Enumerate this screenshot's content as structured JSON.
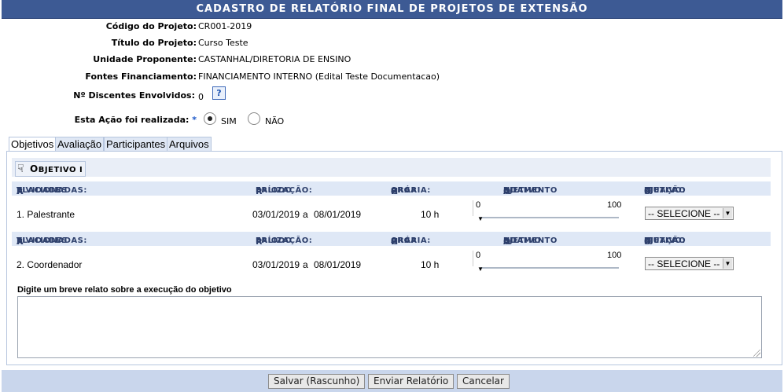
{
  "form": {
    "title": "CADASTRO DE RELATÓRIO FINAL DE PROJETOS DE EXTENSÃO",
    "fields": {
      "codigo_label": "Código do Projeto:",
      "codigo_value": "CR001-2019",
      "titulo_label": "Título do Projeto:",
      "titulo_value": "Curso Teste",
      "unidade_label": "Unidade Proponente:",
      "unidade_value": "CASTANHAL/DIRETORIA DE ENSINO",
      "fontes_label": "Fontes Financiamento:",
      "fontes_value": "FINANCIAMENTO INTERNO (Edital Teste Documentacao)",
      "discentes_label": "Nº Discentes Envolvidos:",
      "discentes_value": "0",
      "help_icon": "?",
      "realizada_label": "Esta Ação foi realizada:",
      "required_mark": "*",
      "sim_label": "SIM",
      "nao_label": "NÃO",
      "realizada_selected": "SIM"
    }
  },
  "tabs": [
    {
      "label": "Objetivos",
      "active": true
    },
    {
      "label": "Avaliação",
      "active": false
    },
    {
      "label": "Participantes",
      "active": false
    },
    {
      "label": "Arquivos",
      "active": false
    }
  ],
  "objective": {
    "button_first": "O",
    "button_rest": "BJETIVO I",
    "headers": {
      "atividades_cap": "A",
      "atividades_rest": "TIVIDADES ",
      "atividades_cap2": "R",
      "atividades_rest2": "ELACIONADAS:",
      "periodo_cap": "P",
      "periodo_rest": "ERÍODO ",
      "periodo_cap2": "R",
      "periodo_rest2": "EALIZAÇÃO:",
      "carga_cap": "C",
      "carga_rest": "ARGA ",
      "carga_cap2": "H",
      "carga_rest2": "ORÁRIA:",
      "andamento_cap": "A",
      "andamento_rest": "NDAMENTO ",
      "andamento_cap2": "O",
      "andamento_rest2": "BJETIVO:",
      "situacao_cap": "S",
      "situacao_rest": "ITUAÇÃO ",
      "situacao_cap2": "O",
      "situacao_rest2": "BJETIVO:"
    },
    "activities": [
      {
        "name": "1. Palestrante",
        "start": "03/01/2019",
        "sep": "a",
        "end": "08/01/2019",
        "hours": "10 h",
        "progress_min": "0",
        "progress_max": "100",
        "progress": 0,
        "situacao": "-- SELECIONE --"
      },
      {
        "name": "2. Coordenador",
        "start": "03/01/2019",
        "sep": "a",
        "end": "08/01/2019",
        "hours": "10 h",
        "progress_min": "0",
        "progress_max": "100",
        "progress": 0,
        "situacao": "-- SELECIONE --"
      }
    ],
    "relato_label": "Digite um breve relato sobre a execução do objetivo",
    "relato_value": ""
  },
  "footer": {
    "save_label": "Salvar (Rascunho)",
    "send_label": "Enviar Relatório",
    "cancel_label": "Cancelar"
  }
}
